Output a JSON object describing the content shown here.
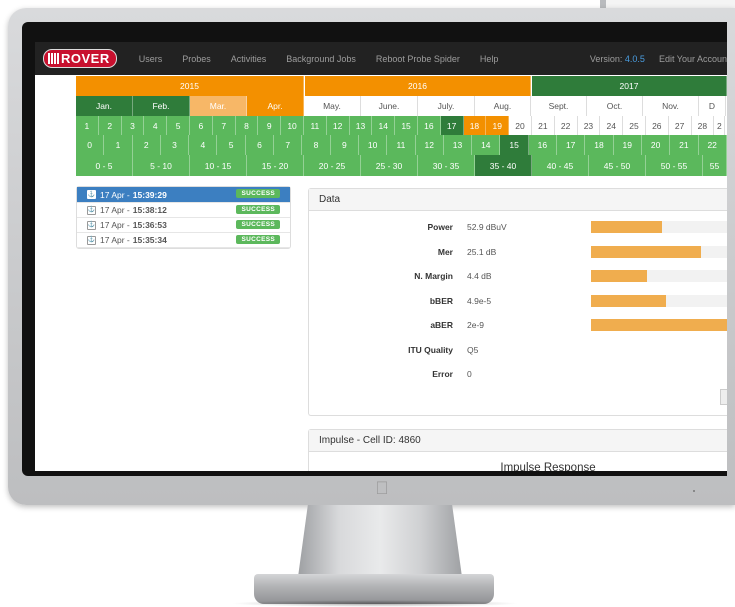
{
  "nav": {
    "brand": "ROVER",
    "items": [
      "Users",
      "Probes",
      "Activities",
      "Background Jobs",
      "Reboot Probe Spider",
      "Help"
    ],
    "version_label": "Version:",
    "version_value": "4.0.5",
    "account": "Edit Your Accoun"
  },
  "timeline": {
    "years": [
      "2015",
      "2016",
      "2017"
    ],
    "months": [
      "Jan.",
      "Feb.",
      "Mar.",
      "Apr.",
      "May.",
      "June.",
      "July.",
      "Aug.",
      "Sept.",
      "Oct.",
      "Nov.",
      "D"
    ],
    "days": [
      "1",
      "2",
      "3",
      "4",
      "5",
      "6",
      "7",
      "8",
      "9",
      "10",
      "11",
      "12",
      "13",
      "14",
      "15",
      "16",
      "17",
      "18",
      "19",
      "20",
      "21",
      "22",
      "23",
      "24",
      "25",
      "26",
      "27",
      "28",
      "2"
    ],
    "hours": [
      "0",
      "1",
      "2",
      "3",
      "4",
      "5",
      "6",
      "7",
      "8",
      "9",
      "10",
      "11",
      "12",
      "13",
      "14",
      "15",
      "16",
      "17",
      "18",
      "19",
      "20",
      "21",
      "22"
    ],
    "ranges": [
      "0 - 5",
      "5 - 10",
      "10 - 15",
      "15 - 20",
      "20 - 25",
      "25 - 30",
      "30 - 35",
      "35 - 40",
      "40 - 45",
      "45 - 50",
      "50 - 55",
      "55"
    ]
  },
  "list": [
    {
      "date": "17 Apr -",
      "time": "15:39:29",
      "status": "SUCCESS",
      "active": true
    },
    {
      "date": "17 Apr -",
      "time": "15:38:12",
      "status": "SUCCESS",
      "active": false
    },
    {
      "date": "17 Apr -",
      "time": "15:36:53",
      "status": "SUCCESS",
      "active": false
    },
    {
      "date": "17 Apr -",
      "time": "15:35:34",
      "status": "SUCCESS",
      "active": false
    }
  ],
  "data_panel": {
    "title": "Data",
    "metrics": [
      {
        "label": "Power",
        "value": "52.9 dBuV",
        "level": 0.52
      },
      {
        "label": "Mer",
        "value": "25.1 dB",
        "level": 0.8
      },
      {
        "label": "N. Margin",
        "value": "4.4 dB",
        "level": 0.41
      },
      {
        "label": "bBER",
        "value": "4.9e-5",
        "level": 0.55
      },
      {
        "label": "aBER",
        "value": "2e-9",
        "level": 1.0
      },
      {
        "label": "ITU Quality",
        "value": "Q5",
        "level": null
      },
      {
        "label": "Error",
        "value": "0",
        "level": null
      }
    ]
  },
  "impulse_panel": {
    "title": "Impulse  - Cell ID: 4860",
    "chart_title": "Impulse Response"
  },
  "colors": {
    "orange": "#f39000",
    "light_orange": "#f7b767",
    "green": "#5bb85c",
    "dark_green": "#2f7c3a",
    "blue": "#3c7fc1",
    "bar": "#f0ad4e"
  }
}
